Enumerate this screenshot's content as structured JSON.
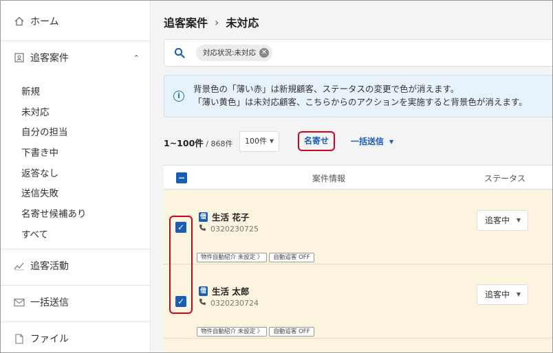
{
  "sidebar": {
    "home": "ホーム",
    "customer_cases": "追客案件",
    "sub_items": [
      "新規",
      "未対応",
      "自分の担当",
      "下書き中",
      "返答なし",
      "送信失敗",
      "名寄せ候補あり",
      "すべて"
    ],
    "activity": "追客活動",
    "bulk_send": "一括送信",
    "files": "ファイル"
  },
  "breadcrumb": {
    "parent": "追客案件",
    "separator": "›",
    "current": "未対応"
  },
  "search": {
    "chip": "対応状況:未対応",
    "chip_remove": "✕"
  },
  "info": {
    "line1": "背景色の「薄い赤」は新規顧客、ステータスの変更で色が消えます。",
    "line2": "「薄い黄色」は未対応顧客、こちらからのアクションを実施すると背景色が消えます。"
  },
  "toolbar": {
    "range": "1~100件",
    "total": " / 868件",
    "per_page": "100件",
    "nayose": "名寄せ",
    "bulk_send": "一括送信"
  },
  "table": {
    "col_info": "案件情報",
    "col_status": "ステータス",
    "rows": [
      {
        "badge": "借",
        "name": "生活 花子",
        "phone": "0320230725",
        "tag1": "物件自動紹介 未設定 〉",
        "tag2": "自動追客 OFF",
        "status": "追客中"
      },
      {
        "badge": "借",
        "name": "生活 太郎",
        "phone": "0320230724",
        "tag1": "物件自動紹介 未設定 〉",
        "tag2": "自動追客 OFF",
        "status": "追客中"
      }
    ]
  },
  "colors": {
    "accent": "#1a5db5",
    "highlight_red": "#d7001c",
    "row_bg": "#fcf4df",
    "info_bg": "#e8f2fb"
  }
}
